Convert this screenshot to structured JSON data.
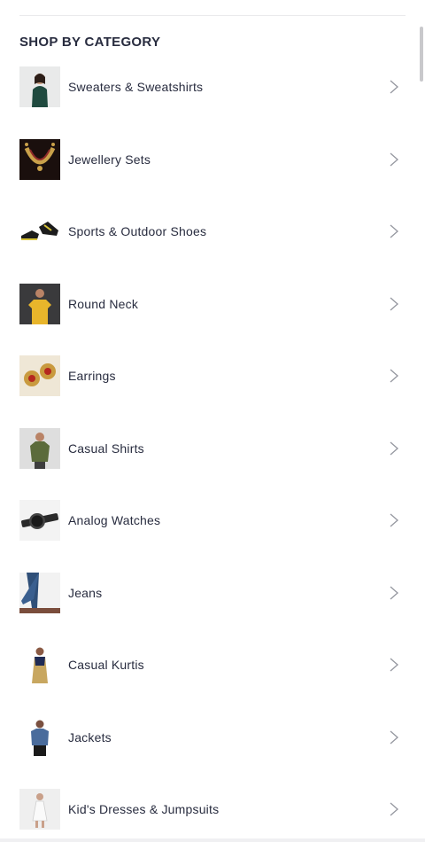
{
  "section": {
    "title": "SHOP BY CATEGORY"
  },
  "categories": [
    {
      "label": "Sweaters & Sweatshirts",
      "thumb": "green-hoodie-model"
    },
    {
      "label": "Jewellery Sets",
      "thumb": "gold-necklace-set"
    },
    {
      "label": "Sports & Outdoor Shoes",
      "thumb": "black-yellow-sneakers"
    },
    {
      "label": "Round Neck",
      "thumb": "yellow-tshirt-model"
    },
    {
      "label": "Earrings",
      "thumb": "gold-red-earrings"
    },
    {
      "label": "Casual Shirts",
      "thumb": "olive-shirt-model"
    },
    {
      "label": "Analog Watches",
      "thumb": "black-watch"
    },
    {
      "label": "Jeans",
      "thumb": "blue-jeans"
    },
    {
      "label": "Casual Kurtis",
      "thumb": "kurti-model"
    },
    {
      "label": "Jackets",
      "thumb": "denim-jacket-model"
    },
    {
      "label": "Kid's Dresses & Jumpsuits",
      "thumb": "kids-dress"
    }
  ],
  "icons": {
    "row_arrow": "chevron-right-icon"
  },
  "colors": {
    "text": "#282c3f",
    "chevron": "#94969f",
    "divider": "#eaeaec"
  }
}
